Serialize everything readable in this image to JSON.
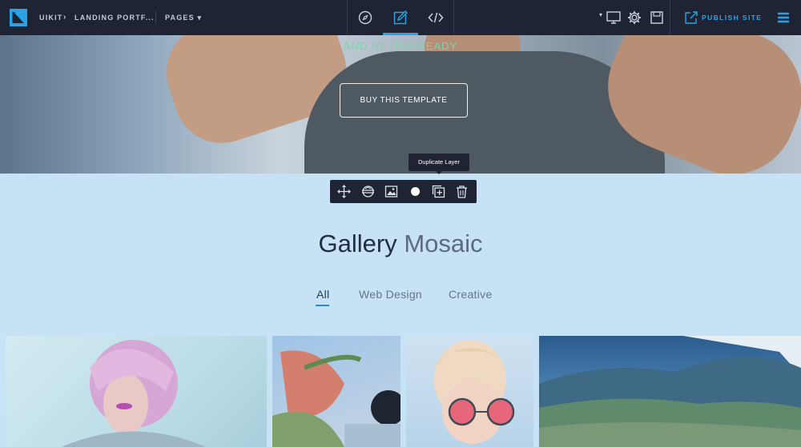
{
  "topbar": {
    "brand": "UIKIT",
    "project": "LANDING PORTF...",
    "pages_label": "PAGES",
    "publish_label": "PUBLISH SITE",
    "center_icons": [
      "compass-icon",
      "edit-icon",
      "code-icon"
    ],
    "right_icons": [
      "desktop-icon",
      "gear-icon",
      "save-icon",
      "publish-icon",
      "menu-icon"
    ],
    "accent": "#29a3e6"
  },
  "hero": {
    "tagline": "AND RETINA READY",
    "cta": "BUY THIS TEMPLATE"
  },
  "layer_toolbar": {
    "tooltip": "Duplicate Layer",
    "icons": [
      "move-icon",
      "swap-icon",
      "image-icon",
      "circle-icon",
      "duplicate-icon",
      "trash-icon"
    ]
  },
  "gallery": {
    "title_bold": "Gallery",
    "title_light": "Mosaic",
    "filters": [
      "All",
      "Web Design",
      "Creative"
    ],
    "active_filter": "All",
    "background": "#c7e1f5"
  }
}
